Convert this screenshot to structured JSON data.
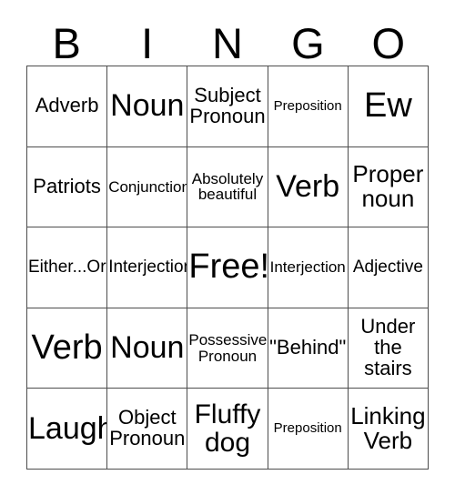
{
  "header": {
    "letters": [
      "B",
      "I",
      "N",
      "G",
      "O"
    ]
  },
  "grid": {
    "rows": [
      [
        {
          "text": "Adverb",
          "size": "fs-m"
        },
        {
          "text": "Noun",
          "size": "fs-xxl"
        },
        {
          "text": "Subject\nPronoun",
          "size": "fs-m"
        },
        {
          "text": "Preposition",
          "size": "fs-xxs"
        },
        {
          "text": "Ew",
          "size": "fs-max"
        }
      ],
      [
        {
          "text": "Patriots",
          "size": "fs-m"
        },
        {
          "text": "Conjunction",
          "size": "fs-xs"
        },
        {
          "text": "Absolutely\nbeautiful",
          "size": "fs-xs"
        },
        {
          "text": "Verb",
          "size": "fs-xxl"
        },
        {
          "text": "Proper\nnoun",
          "size": "fs-l"
        }
      ],
      [
        {
          "text": "Either...Or",
          "size": "fs-s"
        },
        {
          "text": "Interjection",
          "size": "fs-s"
        },
        {
          "text": "Free!",
          "size": "fs-max"
        },
        {
          "text": "Interjection",
          "size": "fs-xs"
        },
        {
          "text": "Adjective",
          "size": "fs-s"
        }
      ],
      [
        {
          "text": "Verb",
          "size": "fs-max"
        },
        {
          "text": "Noun",
          "size": "fs-xxl"
        },
        {
          "text": "Possessive\nPronoun",
          "size": "fs-xs"
        },
        {
          "text": "\"Behind\"",
          "size": "fs-m"
        },
        {
          "text": "Under\nthe\nstairs",
          "size": "fs-m"
        }
      ],
      [
        {
          "text": "Laugh",
          "size": "fs-xxl"
        },
        {
          "text": "Object\nPronoun",
          "size": "fs-m"
        },
        {
          "text": "Fluffy\ndog",
          "size": "fs-xl"
        },
        {
          "text": "Preposition",
          "size": "fs-xxs"
        },
        {
          "text": "Linking\nVerb",
          "size": "fs-l"
        }
      ]
    ]
  }
}
